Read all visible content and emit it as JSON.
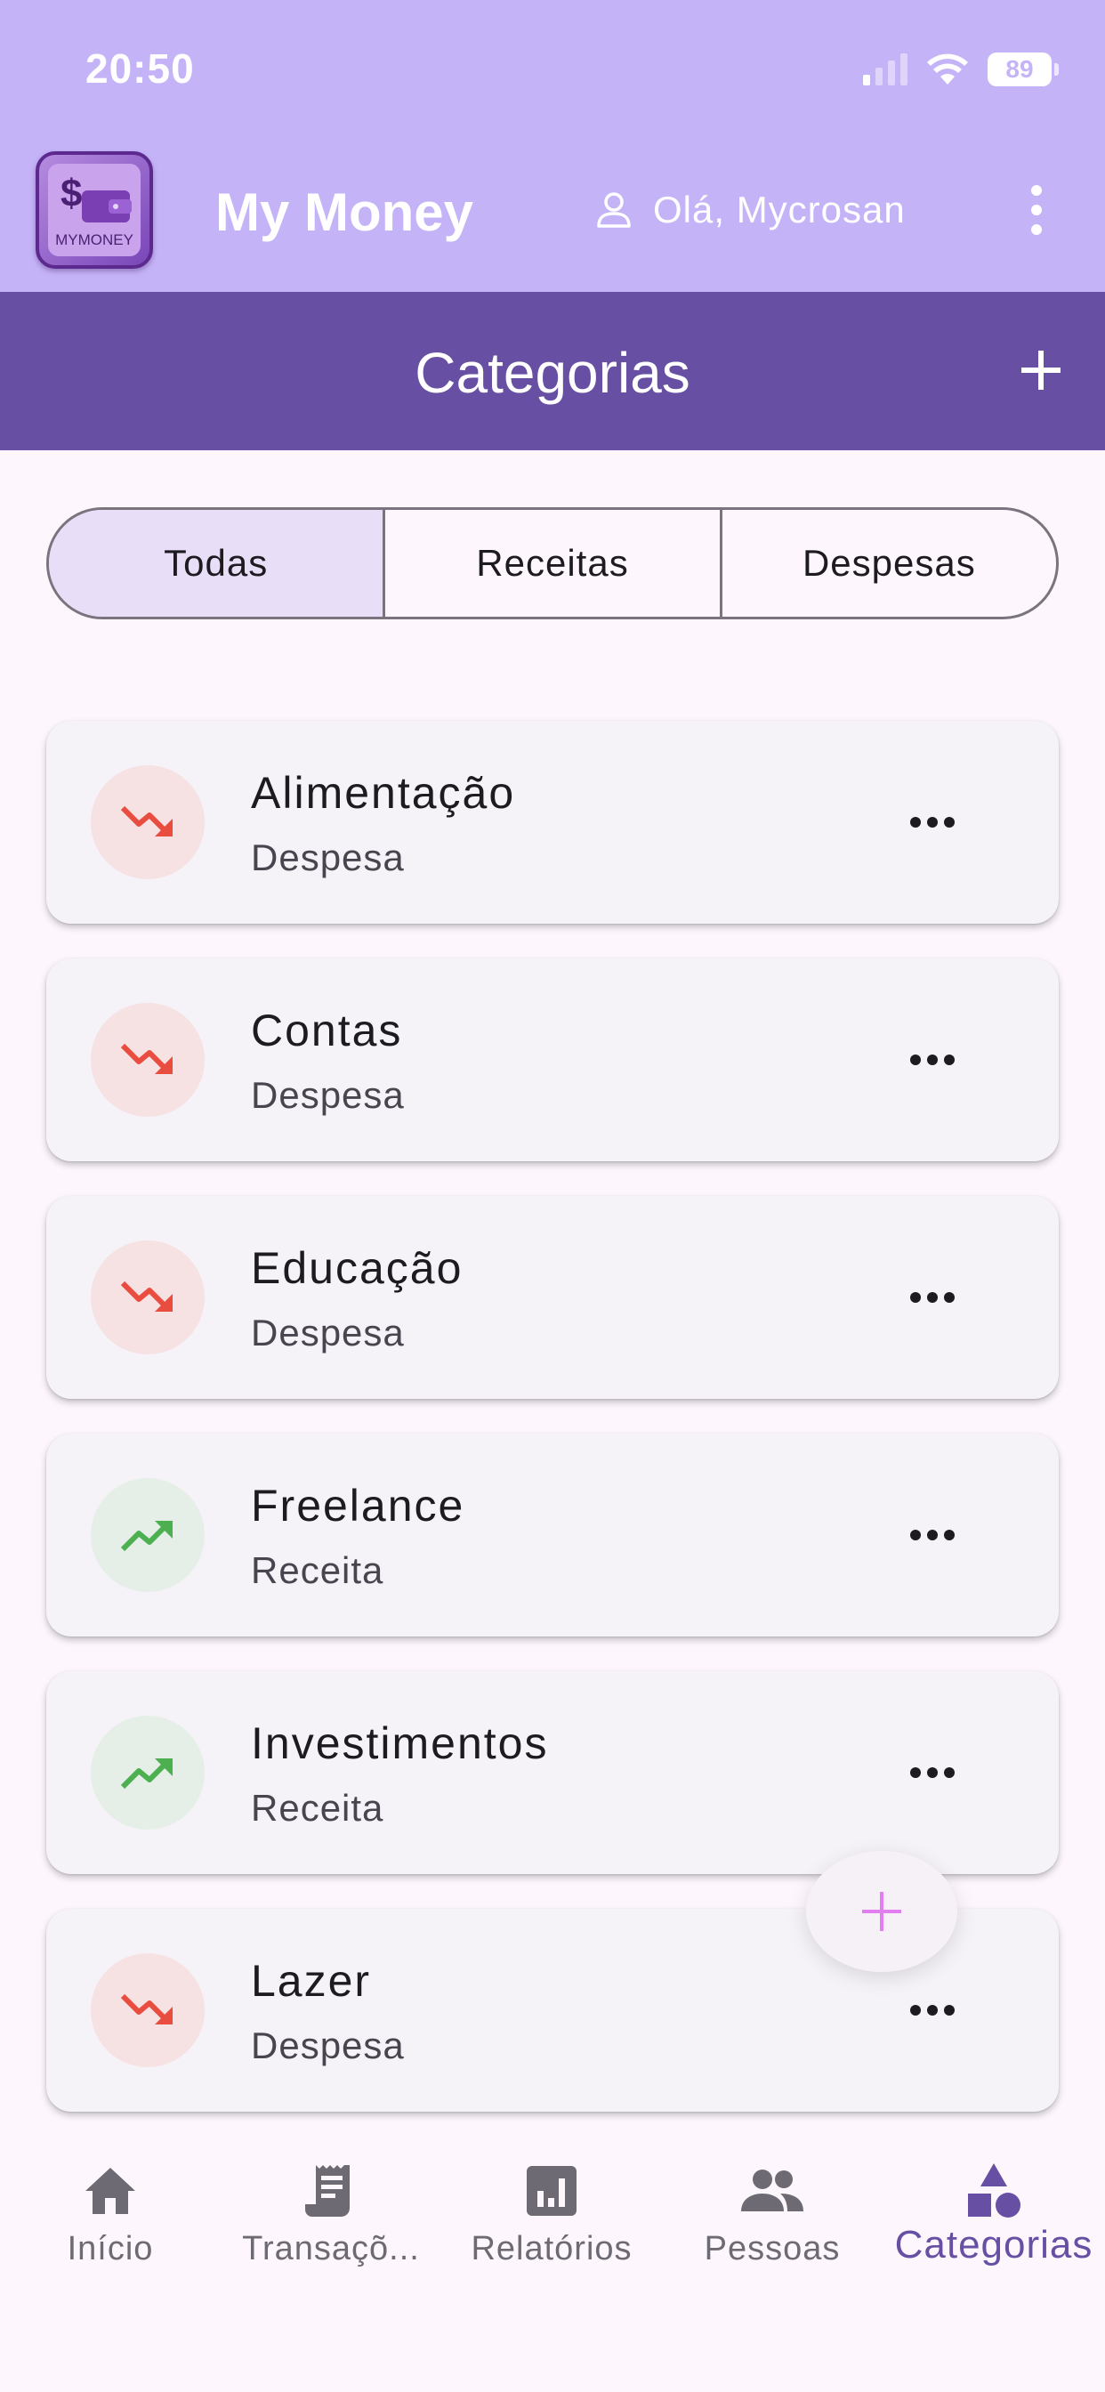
{
  "status_bar": {
    "time": "20:50",
    "battery": "89"
  },
  "app_bar": {
    "logo_text": "MYMONEY",
    "title": "My Money",
    "greeting": "Olá, Mycrosan"
  },
  "page": {
    "title": "Categorias"
  },
  "filter": {
    "options": [
      {
        "label": "Todas",
        "selected": true
      },
      {
        "label": "Receitas",
        "selected": false
      },
      {
        "label": "Despesas",
        "selected": false
      }
    ]
  },
  "categories": [
    {
      "name": "Alimentação",
      "type": "Despesa",
      "kind": "expense"
    },
    {
      "name": "Contas",
      "type": "Despesa",
      "kind": "expense"
    },
    {
      "name": "Educação",
      "type": "Despesa",
      "kind": "expense"
    },
    {
      "name": "Freelance",
      "type": "Receita",
      "kind": "income"
    },
    {
      "name": "Investimentos",
      "type": "Receita",
      "kind": "income"
    },
    {
      "name": "Lazer",
      "type": "Despesa",
      "kind": "expense"
    }
  ],
  "bottom_nav": {
    "items": [
      {
        "label": "Início",
        "icon": "home-icon"
      },
      {
        "label": "Transaçõ...",
        "icon": "receipt-icon"
      },
      {
        "label": "Relatórios",
        "icon": "bar-chart-icon"
      },
      {
        "label": "Pessoas",
        "icon": "people-icon"
      },
      {
        "label": "Categorias",
        "icon": "category-icon",
        "active": true
      }
    ]
  },
  "colors": {
    "status_bar": "#c5b3f8",
    "title_bar": "#6750a4",
    "expense_red": "#e94d3f",
    "income_green": "#4caf50",
    "accent": "#6750a4",
    "fab_plus": "#e27ef0"
  }
}
